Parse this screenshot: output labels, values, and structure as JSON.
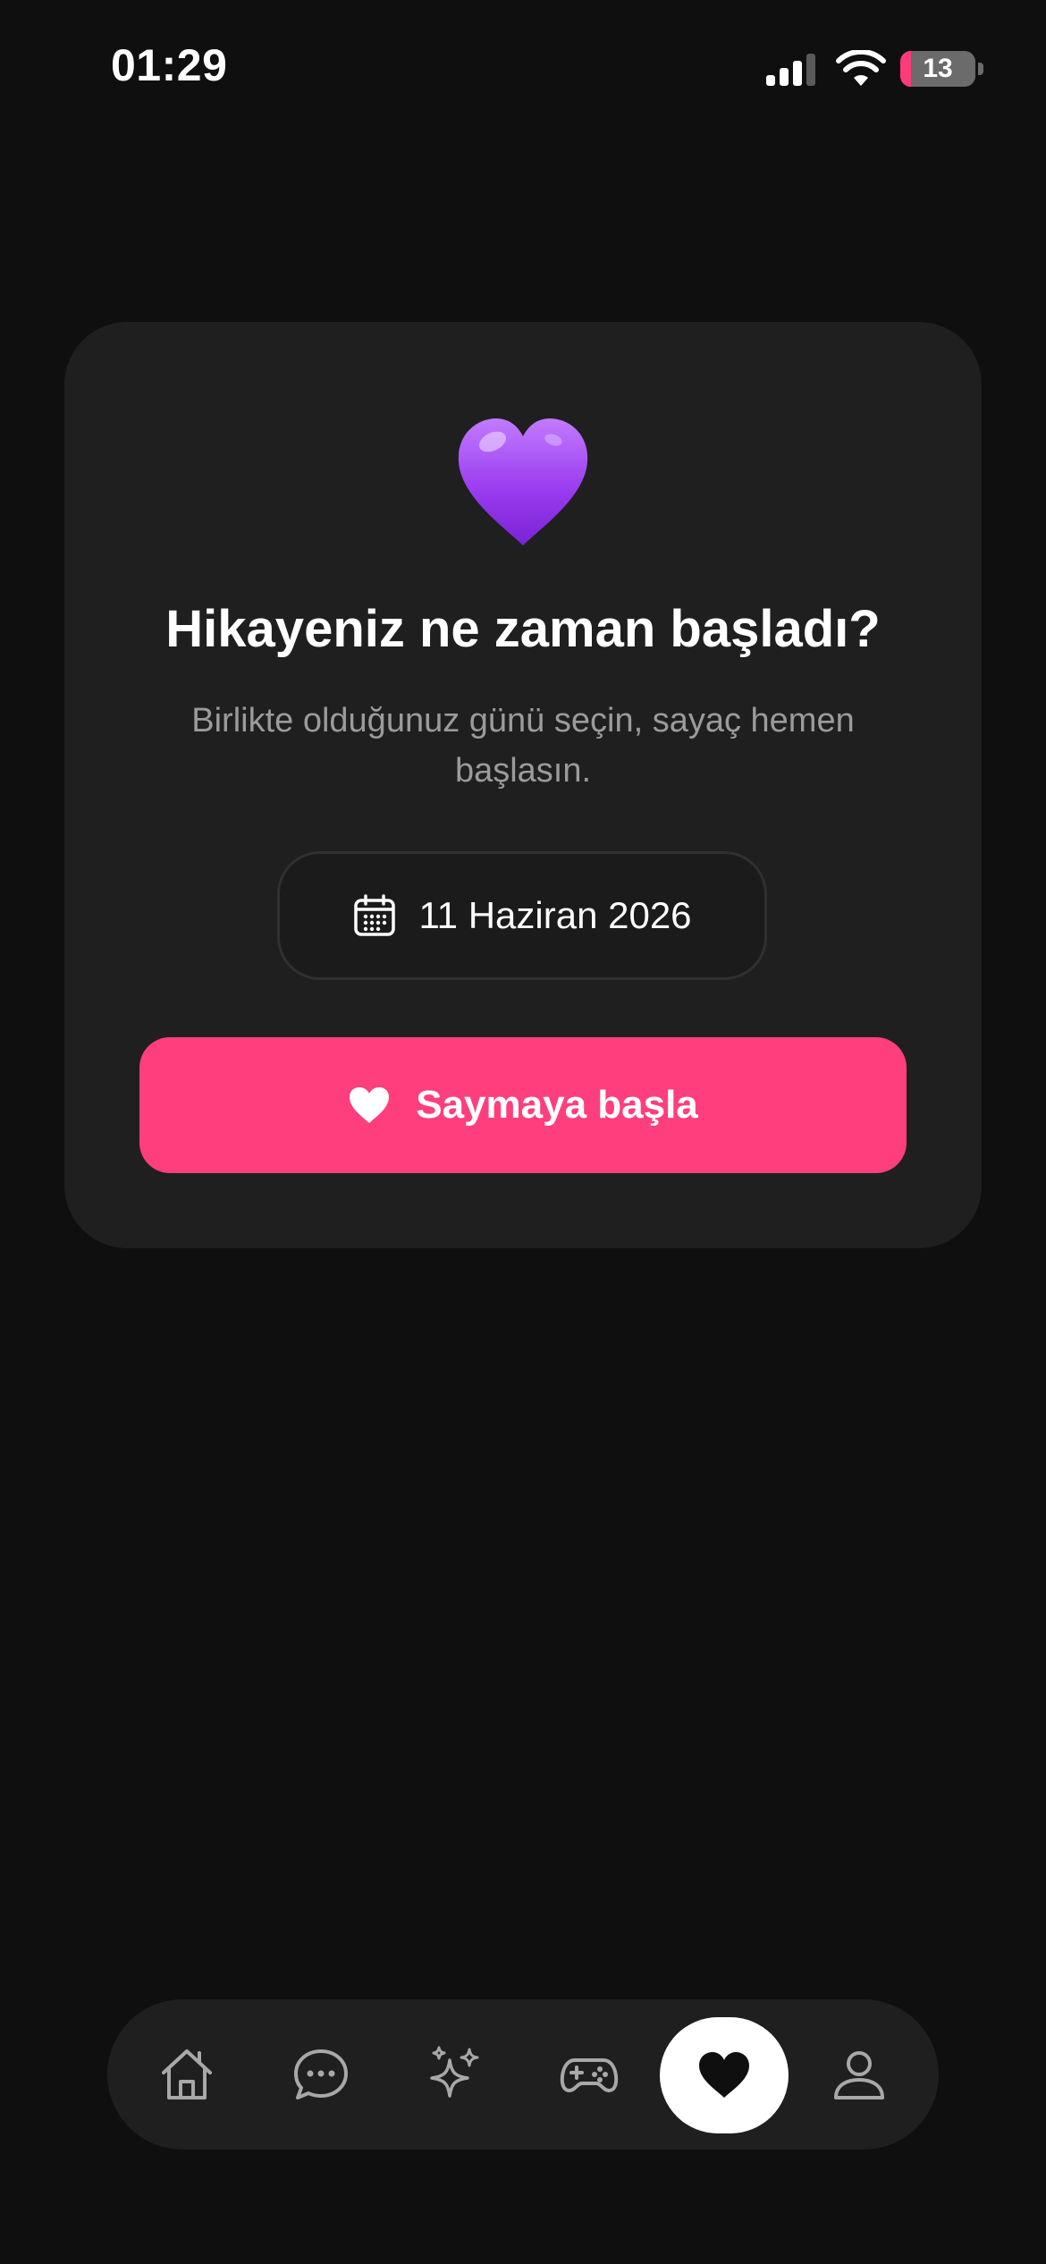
{
  "status_bar": {
    "time": "01:29",
    "battery_level": "13",
    "battery_color": "#ff3b7a"
  },
  "card": {
    "emoji_icon": "purple-heart-emoji",
    "title": "Hikayeniz ne zaman başladı?",
    "subtitle": "Birlikte olduğunuz günü seçin, sayaç hemen başlasın.",
    "date_picker": {
      "icon": "calendar-icon",
      "value": "11 Haziran 2026"
    },
    "start_button": {
      "icon": "heart-icon",
      "label": "Saymaya başla",
      "color": "#ff3e7d"
    }
  },
  "tab_bar": {
    "tabs": [
      {
        "icon": "home-icon",
        "active": false
      },
      {
        "icon": "chat-bubble-icon",
        "active": false
      },
      {
        "icon": "sparkles-icon",
        "active": false
      },
      {
        "icon": "gamepad-icon",
        "active": false
      },
      {
        "icon": "heart-icon",
        "active": true
      },
      {
        "icon": "profile-icon",
        "active": false
      }
    ]
  }
}
